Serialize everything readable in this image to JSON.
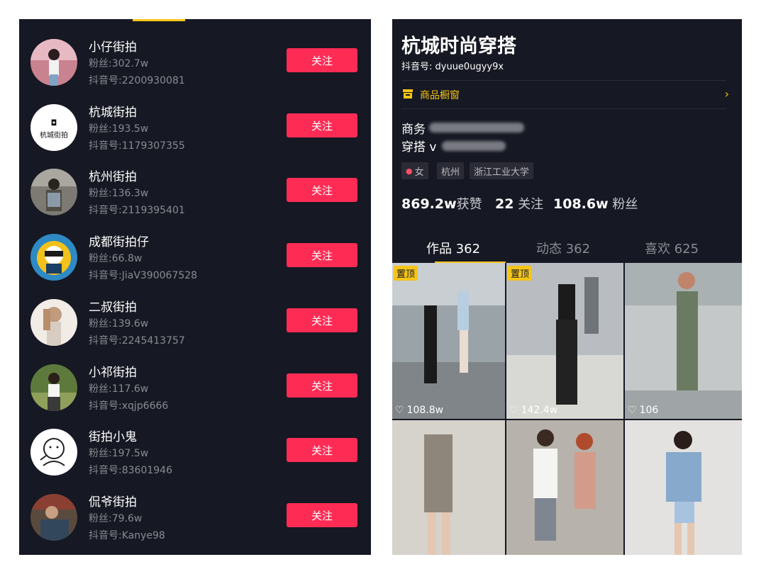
{
  "left_panel": {
    "accounts": [
      {
        "name": "小仔街拍",
        "fans": "粉丝:302.7w",
        "douyin_id": "抖音号:2200930081",
        "follow": "关注"
      },
      {
        "name": "杭城街拍",
        "fans": "粉丝:193.5w",
        "douyin_id": "抖音号:1179307355",
        "follow": "关注",
        "avatar_text": "杭城街拍"
      },
      {
        "name": "杭州街拍",
        "fans": "粉丝:136.3w",
        "douyin_id": "抖音号:2119395401",
        "follow": "关注"
      },
      {
        "name": "成都街拍仔",
        "fans": "粉丝:66.8w",
        "douyin_id": "抖音号:JiaV390067528",
        "follow": "关注"
      },
      {
        "name": "二叔街拍",
        "fans": "粉丝:139.6w",
        "douyin_id": "抖音号:2245413757",
        "follow": "关注"
      },
      {
        "name": "小祁街拍",
        "fans": "粉丝:117.6w",
        "douyin_id": "抖音号:xqjp6666",
        "follow": "关注"
      },
      {
        "name": "街拍小鬼",
        "fans": "粉丝:197.5w",
        "douyin_id": "抖音号:83601946",
        "follow": "关注"
      },
      {
        "name": "侃爷街拍",
        "fans": "粉丝:79.6w",
        "douyin_id": "抖音号:Kanye98",
        "follow": "关注"
      }
    ]
  },
  "profile": {
    "title": "杭城时尚穿搭",
    "douyin_id": "抖音号: dyuue0ugyy9x",
    "shop_label": "商品橱窗",
    "shop_chevron": "›",
    "bio_line1": "商务",
    "bio_line2": "穿搭 v",
    "tags": {
      "gender": "女",
      "city": "杭州",
      "school": "浙江工业大学"
    },
    "stats": {
      "likes_value": "869.2w",
      "likes_label": "获赞",
      "following_value": "22",
      "following_label": "关注",
      "fans_value": "108.6w",
      "fans_label": "粉丝"
    },
    "tabs": {
      "works": "作品 362",
      "dynamic": "动态 362",
      "likes": "喜欢 625"
    },
    "pinned_label": "置顶",
    "posts": [
      {
        "likes": "108.8w",
        "pinned": true
      },
      {
        "likes": "142.4w",
        "pinned": true
      },
      {
        "likes": "106",
        "pinned": false
      },
      {
        "likes": "",
        "pinned": false
      },
      {
        "likes": "",
        "pinned": false
      },
      {
        "likes": "",
        "pinned": false
      }
    ]
  },
  "colors": {
    "background": "#161823",
    "follow_button": "#fe2c55",
    "accent_yellow": "#f5c518",
    "muted_text": "#8a8b91"
  }
}
